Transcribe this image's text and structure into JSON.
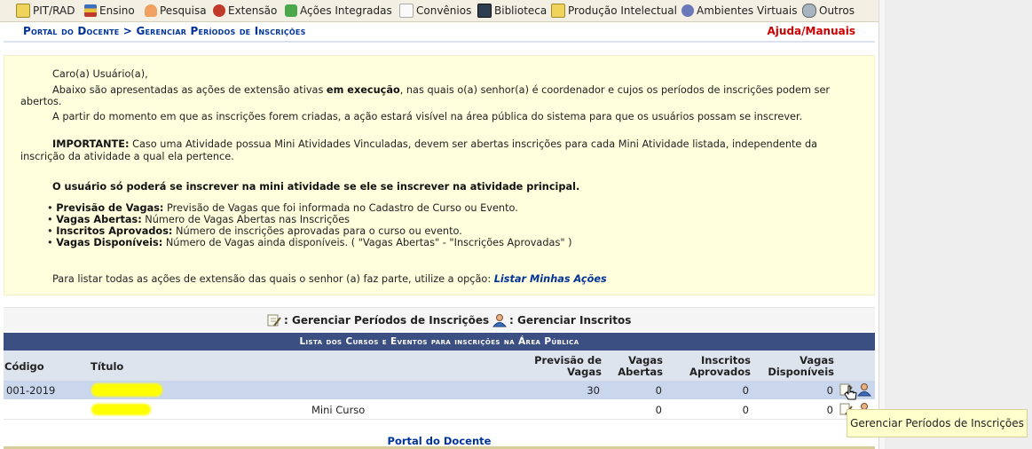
{
  "menu": {
    "items": [
      {
        "label": "PIT/RAD",
        "icon": "notepad-icon",
        "color": "#e8c33a"
      },
      {
        "label": "Ensino",
        "icon": "books-icon",
        "color": "#3a6fc2"
      },
      {
        "label": "Pesquisa",
        "icon": "flask-icon",
        "color": "#e07a2a"
      },
      {
        "label": "Extensão",
        "icon": "tools-icon",
        "color": "#c0392b"
      },
      {
        "label": "Ações Integradas",
        "icon": "puzzle-icon",
        "color": "#3b9b3b"
      },
      {
        "label": "Convênios",
        "icon": "documents-icon",
        "color": "#d0d0d0"
      },
      {
        "label": "Biblioteca",
        "icon": "library-icon",
        "color": "#2c3e50"
      },
      {
        "label": "Produção Intelectual",
        "icon": "notebook-icon",
        "color": "#e8c33a"
      },
      {
        "label": "Ambientes Virtuais",
        "icon": "network-icon",
        "color": "#5566aa"
      },
      {
        "label": "Outros",
        "icon": "globe-icon",
        "color": "#8a9aa8"
      }
    ]
  },
  "header": {
    "title": "Portal do Docente > Gerenciar Períodos de Inscrições",
    "help": "Ajuda/Manuais"
  },
  "info": {
    "greeting": "Caro(a) Usuário(a),",
    "line1_a": "Abaixo são apresentadas as ações de extensão ativas ",
    "line1_b": "em execução",
    "line1_c": ", nas quais o(a) senhor(a) é coordenador e cujos os períodos de inscrições podem ser",
    "line1_d": "abertos.",
    "line2": "A partir do momento em que as inscrições forem criadas, a ação estará visível na área pública do sistema para que os usuários possam se inscrever.",
    "important_label": "IMPORTANTE:",
    "important_text": " Caso uma Atividade possua Mini Atividades Vinculadas, devem ser abertas inscrições para cada Mini Atividade listada, independente da",
    "important_text2": "inscrição da atividade a qual ela pertence.",
    "bold_notice": "O usuário só poderá se inscrever na mini atividade se ele se inscrever na atividade principal.",
    "bullets": [
      {
        "term": "Previsão de Vagas:",
        "desc": " Previsão de Vagas que foi informada no Cadastro de Curso ou Evento."
      },
      {
        "term": "Vagas Abertas:",
        "desc": " Número de Vagas Abertas nas Inscrições"
      },
      {
        "term": "Inscritos Aprovados:",
        "desc": " Número de inscrições aprovadas para o curso ou evento."
      },
      {
        "term": "Vagas Disponíveis:",
        "desc": " Número de Vagas ainda disponíveis. ( \"Vagas Abertas\" - \"Inscrições Aprovadas\" )"
      }
    ],
    "list_text": "Para listar todas as ações de extensão das quais o senhor (a) faz parte, utilize a opção: ",
    "list_link": "Listar Minhas Ações"
  },
  "legend": {
    "manage_periods": ": Gerenciar Períodos de Inscrições",
    "manage_enrolled": ": Gerenciar Inscritos"
  },
  "table": {
    "caption": "Lista dos Cursos e Eventos para inscrições na Área Pública",
    "headers": {
      "codigo": "Código",
      "titulo": "Título",
      "previsao_1": "Previsão de",
      "previsao_2": "Vagas",
      "abertas_1": "Vagas",
      "abertas_2": "Abertas",
      "aprovados_1": "Inscritos",
      "aprovados_2": "Aprovados",
      "disponiveis_1": "Vagas",
      "disponiveis_2": "Disponíveis"
    },
    "rows": [
      {
        "codigo": "001-2019",
        "titulo": "",
        "previsao": "30",
        "abertas": "0",
        "aprovados": "0",
        "disponiveis": "0"
      },
      {
        "codigo": "",
        "titulo": "Mini Curso",
        "previsao": "",
        "abertas": "0",
        "aprovados": "0",
        "disponiveis": "0"
      }
    ],
    "highlight_color": "#ffff00"
  },
  "footer": {
    "link": "Portal do Docente"
  },
  "tooltip": {
    "text": "Gerenciar Períodos de Inscrições"
  }
}
